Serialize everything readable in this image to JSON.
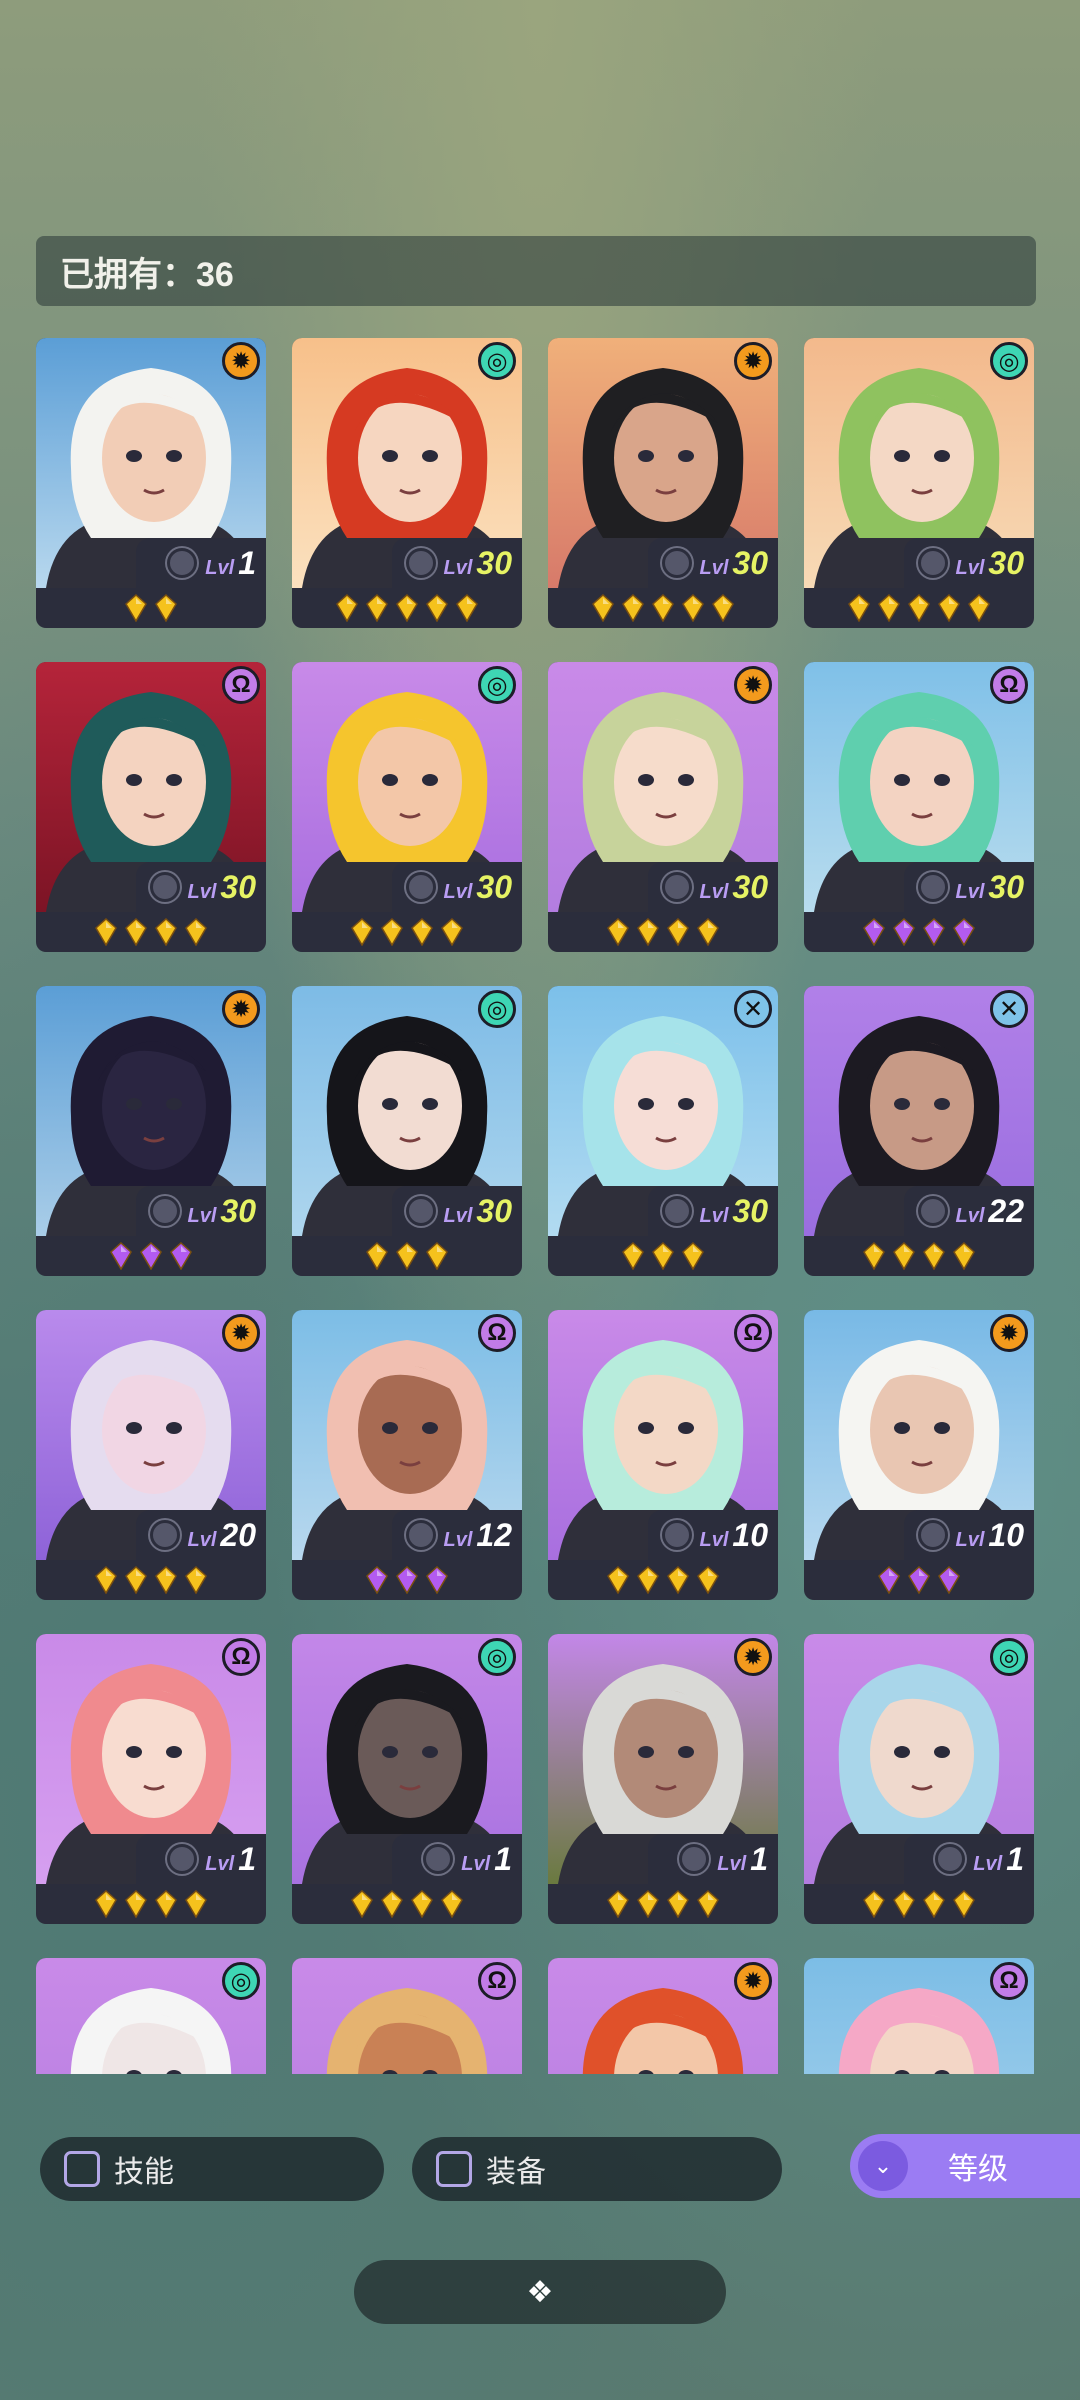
{
  "owned": {
    "label": "已拥有：36"
  },
  "controls": {
    "skill_label": "技能",
    "equip_label": "装备",
    "level_label": "等级"
  },
  "colors": {
    "gem_gold": "#f5c21d",
    "gem_purple": "#b35bf0",
    "max_level": "#e6f364",
    "accent": "#9b7cf3"
  },
  "cards": [
    {
      "element": "sun",
      "lvl_prefix": "Lvl",
      "level": "1",
      "stars": 2,
      "gem": "gold",
      "bg": [
        "#5b9ed6",
        "#b8d8ee"
      ],
      "hair": "#f3f3f0",
      "skin": "#f2cdb6"
    },
    {
      "element": "swirl",
      "lvl_prefix": "Lvl",
      "level": "30",
      "stars": 5,
      "gem": "gold",
      "bg": [
        "#f7c08a",
        "#fbe1bf"
      ],
      "hair": "#d63a22",
      "skin": "#f6d6c0"
    },
    {
      "element": "sun",
      "lvl_prefix": "Lvl",
      "level": "30",
      "stars": 5,
      "gem": "gold",
      "bg": [
        "#f0b07a",
        "#d77a6a"
      ],
      "hair": "#1f1f22",
      "skin": "#d9a58a"
    },
    {
      "element": "swirl",
      "lvl_prefix": "Lvl",
      "level": "30",
      "stars": 5,
      "gem": "gold",
      "bg": [
        "#f3b98c",
        "#f7dab6"
      ],
      "hair": "#8fc25f",
      "skin": "#f4d8c5"
    },
    {
      "element": "spirit",
      "lvl_prefix": "Lvl",
      "level": "30",
      "stars": 4,
      "gem": "gold",
      "bg": [
        "#b5243a",
        "#7c1425"
      ],
      "hair": "#1f5b5a",
      "skin": "#f4d3c0"
    },
    {
      "element": "swirl",
      "lvl_prefix": "Lvl",
      "level": "30",
      "stars": 4,
      "gem": "gold",
      "bg": [
        "#c88ae8",
        "#a96fe0"
      ],
      "hair": "#f5c52d",
      "skin": "#f3c7a8"
    },
    {
      "element": "sun",
      "lvl_prefix": "Lvl",
      "level": "30",
      "stars": 4,
      "gem": "gold",
      "bg": [
        "#c98ae8",
        "#b37de0"
      ],
      "hair": "#c7d39b",
      "skin": "#f6dccb"
    },
    {
      "element": "spirit",
      "lvl_prefix": "Lvl",
      "level": "30",
      "stars": 4,
      "gem": "purple",
      "bg": [
        "#7fc0e8",
        "#b8dcee"
      ],
      "hair": "#5fcfae",
      "skin": "#f3d3c2"
    },
    {
      "element": "sun",
      "lvl_prefix": "Lvl",
      "level": "30",
      "stars": 3,
      "gem": "purple",
      "bg": [
        "#5b9ed6",
        "#a9cde8"
      ],
      "hair": "#1f1b33",
      "skin": "#2a2541"
    },
    {
      "element": "swirl",
      "lvl_prefix": "Lvl",
      "level": "30",
      "stars": 3,
      "gem": "gold",
      "bg": [
        "#7dbbe6",
        "#aed6ee"
      ],
      "hair": "#15151a",
      "skin": "#f2dcd2"
    },
    {
      "element": "cross",
      "lvl_prefix": "Lvl",
      "level": "30",
      "stars": 3,
      "gem": "gold",
      "bg": [
        "#7cc0ea",
        "#b2dbf1"
      ],
      "hair": "#a6e3ea",
      "skin": "#f6ddd6"
    },
    {
      "element": "cross",
      "lvl_prefix": "Lvl",
      "level": "22",
      "stars": 4,
      "gem": "gold",
      "bg": [
        "#b180e8",
        "#9a6ee0"
      ],
      "hair": "#1c1a22",
      "skin": "#c79a86"
    },
    {
      "element": "sun",
      "lvl_prefix": "Lvl",
      "level": "20",
      "stars": 4,
      "gem": "gold",
      "bg": [
        "#b98aec",
        "#8e63d8"
      ],
      "hair": "#e5dcef",
      "skin": "#f1d6e4"
    },
    {
      "element": "spirit",
      "lvl_prefix": "Lvl",
      "level": "12",
      "stars": 3,
      "gem": "purple",
      "bg": [
        "#7cbde6",
        "#b8d8ee"
      ],
      "hair": "#f1bfb1",
      "skin": "#a86b53"
    },
    {
      "element": "spirit",
      "lvl_prefix": "Lvl",
      "level": "10",
      "stars": 4,
      "gem": "gold",
      "bg": [
        "#c98ae8",
        "#a86fdf"
      ],
      "hair": "#b7ecdc",
      "skin": "#f3d8c6"
    },
    {
      "element": "sun",
      "lvl_prefix": "Lvl",
      "level": "10",
      "stars": 3,
      "gem": "purple",
      "bg": [
        "#78b9e6",
        "#b6d8ef"
      ],
      "hair": "#f5f5f2",
      "skin": "#e9c6b2"
    },
    {
      "element": "spirit",
      "lvl_prefix": "Lvl",
      "level": "1",
      "stars": 4,
      "gem": "gold",
      "bg": [
        "#c98ae8",
        "#d69ff0"
      ],
      "hair": "#f08a8e",
      "skin": "#f8dcd0"
    },
    {
      "element": "swirl",
      "lvl_prefix": "Lvl",
      "level": "1",
      "stars": 4,
      "gem": "gold",
      "bg": [
        "#c387e8",
        "#a872e0"
      ],
      "hair": "#1a1a1f",
      "skin": "#6a5a58"
    },
    {
      "element": "sun",
      "lvl_prefix": "Lvl",
      "level": "1",
      "stars": 4,
      "gem": "gold",
      "bg": [
        "#c387e8",
        "#6a7a3f"
      ],
      "hair": "#d9d9d6",
      "skin": "#b28a78"
    },
    {
      "element": "swirl",
      "lvl_prefix": "Lvl",
      "level": "1",
      "stars": 4,
      "gem": "gold",
      "bg": [
        "#c98ae8",
        "#b37de0"
      ],
      "hair": "#a9d6ea",
      "skin": "#efd9cd"
    },
    {
      "element": "swirl",
      "lvl_prefix": "",
      "level": "",
      "stars": 0,
      "gem": "gold",
      "bg": [
        "#c98ae8",
        "#b37de0"
      ],
      "hair": "#f5f5f5",
      "skin": "#efe6e6"
    },
    {
      "element": "spirit",
      "lvl_prefix": "",
      "level": "",
      "stars": 0,
      "gem": "gold",
      "bg": [
        "#c98ae8",
        "#b37de0"
      ],
      "hair": "#e5b370",
      "skin": "#c98155"
    },
    {
      "element": "sun",
      "lvl_prefix": "",
      "level": "",
      "stars": 0,
      "gem": "gold",
      "bg": [
        "#c98ae8",
        "#b37de0"
      ],
      "hair": "#e0512a",
      "skin": "#f3c7a8"
    },
    {
      "element": "spirit",
      "lvl_prefix": "",
      "level": "",
      "stars": 0,
      "gem": "gold",
      "bg": [
        "#7cbde6",
        "#a9d3ec"
      ],
      "hair": "#f5a8c6",
      "skin": "#f3d6c6"
    }
  ]
}
